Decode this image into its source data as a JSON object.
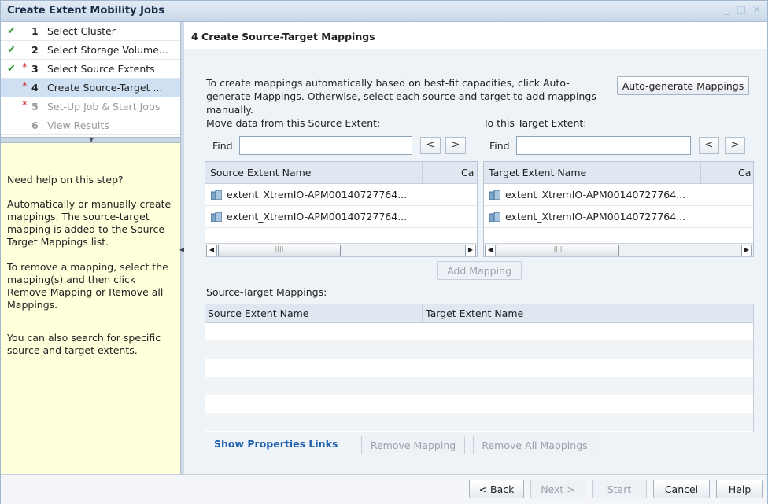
{
  "window": {
    "title": "Create Extent Mobility Jobs",
    "controls": [
      "_",
      "□",
      "×"
    ]
  },
  "steps": [
    {
      "check": "✔",
      "req": "",
      "num": "1",
      "label": "Select Cluster",
      "state": "done"
    },
    {
      "check": "✔",
      "req": "",
      "num": "2",
      "label": "Select Storage Volume...",
      "state": "done"
    },
    {
      "check": "✔",
      "req": "*",
      "num": "3",
      "label": "Select Source Extents",
      "state": "done"
    },
    {
      "check": "",
      "req": "*",
      "num": "4",
      "label": "Create Source-Target ...",
      "state": "active"
    },
    {
      "check": "",
      "req": "*",
      "num": "5",
      "label": "Set-Up Job & Start Jobs",
      "state": "disabled"
    },
    {
      "check": "",
      "req": "",
      "num": "6",
      "label": "View Results",
      "state": "disabled"
    }
  ],
  "help": {
    "heading": "Need help on this step?",
    "p1": "Automatically or manually create mappings. The source-target mapping is added to the Source-Target Mappings list.",
    "p2": "To remove a mapping, select the mapping(s) and then click Remove Mapping or Remove all Mappings.",
    "p3": "You can also search for specific source and target extents."
  },
  "main": {
    "title": "4  Create Source-Target Mappings",
    "intro": "To create mappings automatically based on best-fit capacities, click Auto-generate Mappings. Otherwise, select each source and target to add mappings manually.",
    "auto_button": "Auto-generate Mappings"
  },
  "source": {
    "label": "Move data from this Source Extent:",
    "find_label": "Find",
    "find_value": "",
    "prev": "<",
    "next": ">",
    "columns": [
      "Source Extent Name",
      "Ca"
    ],
    "rows": [
      "extent_XtremIO-APM00140727764...",
      "extent_XtremIO-APM00140727764..."
    ]
  },
  "target": {
    "label": "To this Target Extent:",
    "find_label": "Find",
    "find_value": "",
    "prev": "<",
    "next": ">",
    "columns": [
      "Target Extent Name",
      "Ca"
    ],
    "rows": [
      "extent_XtremIO-APM00140727764...",
      "extent_XtremIO-APM00140727764..."
    ]
  },
  "add_mapping": "Add Mapping",
  "mappings": {
    "label": "Source-Target Mappings:",
    "columns": [
      "Source Extent Name",
      "Target Extent Name"
    ]
  },
  "show_properties": "Show Properties Links",
  "remove_mapping": "Remove Mapping",
  "remove_all": "Remove All Mappings",
  "footer": {
    "back": "< Back",
    "next": "Next >",
    "start": "Start",
    "cancel": "Cancel",
    "help": "Help"
  },
  "colors": {
    "done_check": "#2e9a2e",
    "required_star": "#cc2a2a",
    "active_step": "#cfe0f3",
    "help_bg": "#ffffdc",
    "link": "#1f5fad"
  }
}
